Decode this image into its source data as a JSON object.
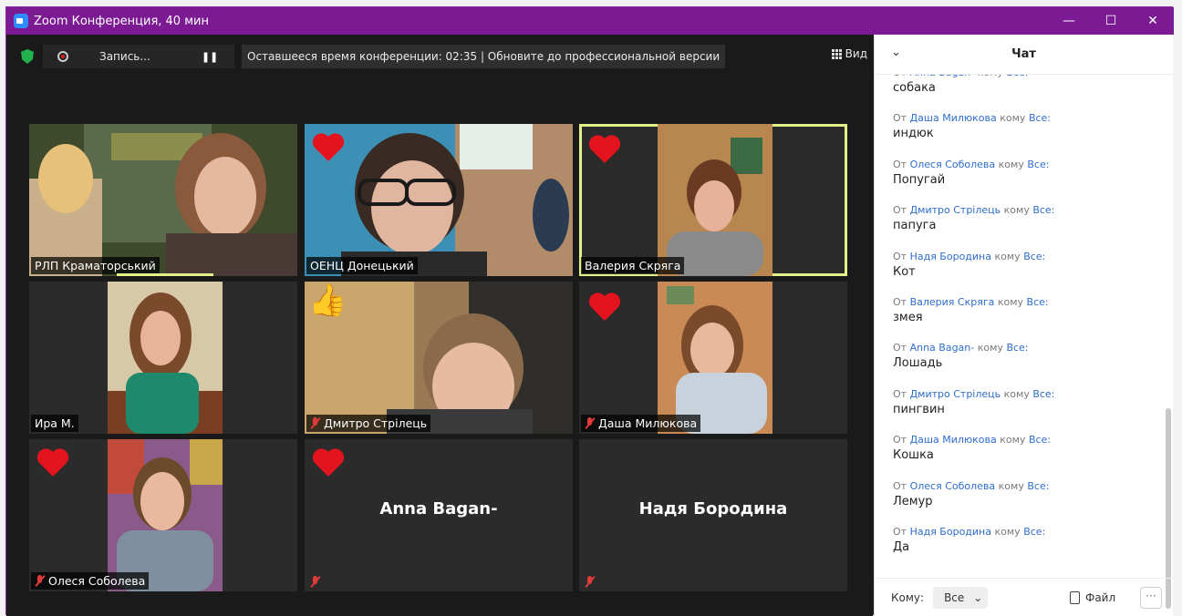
{
  "window": {
    "title": "Zoom Конференция, 40 мин",
    "minimize": "—",
    "maximize": "☐",
    "close": "✕"
  },
  "toolbar": {
    "record_label": "Запись...",
    "pause_glyph": "❚❚",
    "banner": "Оставшееся время конференции: 02:35 | Обновите до профессиональной версии",
    "view_label": "Вид"
  },
  "participants": [
    {
      "name": "РЛП Краматорський",
      "muted": false,
      "reaction": "none"
    },
    {
      "name": "ОЕНЦ Донецький",
      "muted": false,
      "reaction": "heart"
    },
    {
      "name": "Валерия Скряга",
      "muted": false,
      "reaction": "heart",
      "active_speaker": true
    },
    {
      "name": "Ира М.",
      "muted": false,
      "reaction": "none"
    },
    {
      "name": "Дмитро Стрілець",
      "muted": true,
      "reaction": "thumbs-up"
    },
    {
      "name": "Даша Милюкова",
      "muted": true,
      "reaction": "heart"
    },
    {
      "name": "Олеся Соболева",
      "muted": true,
      "reaction": "heart"
    },
    {
      "name": "Anna Bagan-",
      "muted": true,
      "reaction": "heart",
      "camera_off": true
    },
    {
      "name": "Надя Бородина",
      "muted": true,
      "reaction": "none",
      "camera_off": true
    }
  ],
  "chat": {
    "title": "Чат",
    "from_word": "От",
    "to_word": "кому",
    "messages": [
      {
        "sender": "Anna Bagan-",
        "recipient": "Все:",
        "text": "собака"
      },
      {
        "sender": "Даша Милюкова",
        "recipient": "Все:",
        "text": "индюк"
      },
      {
        "sender": "Олеся Соболева",
        "recipient": "Все:",
        "text": "Попугай"
      },
      {
        "sender": "Дмитро Стрілець",
        "recipient": "Все:",
        "text": "папуга"
      },
      {
        "sender": "Надя Бородина",
        "recipient": "Все:",
        "text": "Кот"
      },
      {
        "sender": "Валерия Скряга",
        "recipient": "Все:",
        "text": "змея"
      },
      {
        "sender": "Anna Bagan-",
        "recipient": "Все:",
        "text": "Лошадь"
      },
      {
        "sender": "Дмитро Стрілець",
        "recipient": "Все:",
        "text": "пингвин"
      },
      {
        "sender": "Даша Милюкова",
        "recipient": "Все:",
        "text": "Кошка"
      },
      {
        "sender": "Олеся Соболева",
        "recipient": "Все:",
        "text": "Лемур"
      },
      {
        "sender": "Надя Бородина",
        "recipient": "Все:",
        "text": "Да"
      }
    ],
    "footer": {
      "to_label": "Кому:",
      "to_value": "Все",
      "file_label": "Файл",
      "more_label": "···"
    }
  },
  "colors": {
    "title_bar": "#7b1a93",
    "active_border": "#e3f08a",
    "link_blue": "#2d6dcc",
    "shield_green": "#22b14c"
  }
}
